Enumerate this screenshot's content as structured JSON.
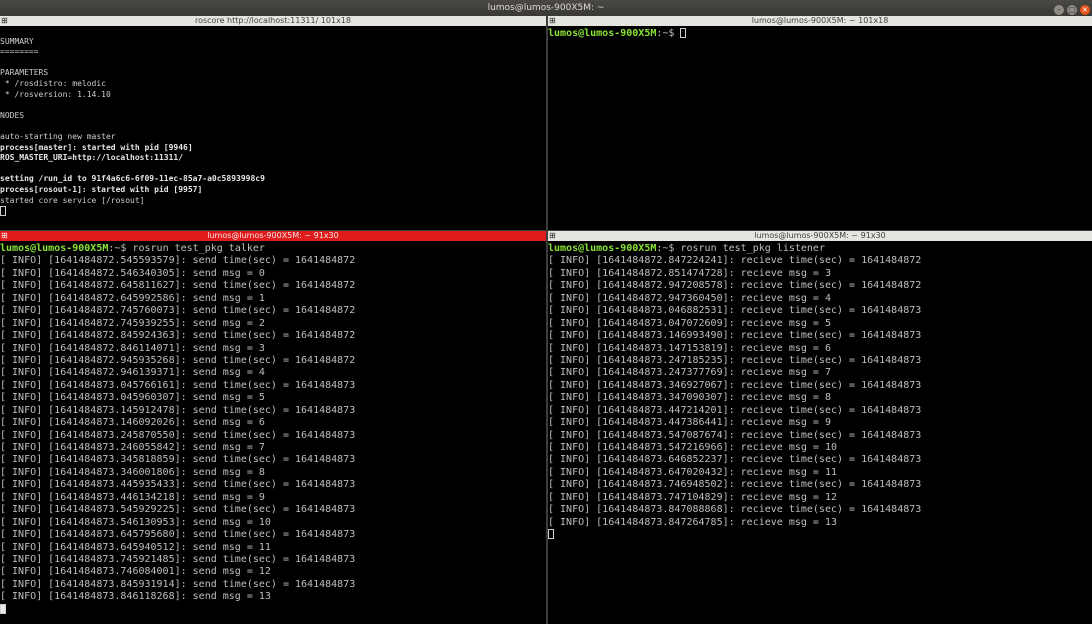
{
  "window": {
    "title": "lumos@lumos-900X5M: ~",
    "icons": [
      "minimize-icon",
      "maximize-icon",
      "close-icon"
    ]
  },
  "panes": {
    "roscore": {
      "title": "roscore http://localhost:11311/ 101x18",
      "lines": [
        {
          "text": "",
          "style": "small"
        },
        {
          "text": "SUMMARY",
          "style": "small"
        },
        {
          "text": "========",
          "style": "small"
        },
        {
          "text": "",
          "style": "small"
        },
        {
          "text": "PARAMETERS",
          "style": "small"
        },
        {
          "text": " * /rosdistro: melodic",
          "style": "small"
        },
        {
          "text": " * /rosversion: 1.14.10",
          "style": "small"
        },
        {
          "text": "",
          "style": "small"
        },
        {
          "text": "NODES",
          "style": "small"
        },
        {
          "text": "",
          "style": "small"
        },
        {
          "text": "auto-starting new master",
          "style": "small"
        },
        {
          "text": "process[master]: started with pid [9946]",
          "style": "small bold"
        },
        {
          "text": "ROS_MASTER_URI=http://localhost:11311/",
          "style": "small bold"
        },
        {
          "text": "",
          "style": "small"
        },
        {
          "text": "setting /run_id to 91f4a6c6-6f09-11ec-85a7-a0c5893998c9",
          "style": "small bold"
        },
        {
          "text": "process[rosout-1]: started with pid [9957]",
          "style": "small bold"
        },
        {
          "text": "started core service [/rosout]",
          "style": "small"
        }
      ]
    },
    "shell": {
      "title": "lumos@lumos-900X5M: ~ 101x18",
      "prompt_user": "lumos@lumos-900X5M",
      "prompt_rest": ":~$ "
    },
    "talker": {
      "title": "lumos@lumos-900X5M: ~ 91x30",
      "prompt_user": "lumos@lumos-900X5M",
      "prompt_rest": ":~$ ",
      "command": "rosrun test_pkg talker",
      "lines": [
        "[ INFO] [1641484872.545593579]: send time(sec) = 1641484872",
        "[ INFO] [1641484872.546340305]: send msg = 0",
        "[ INFO] [1641484872.645811627]: send time(sec) = 1641484872",
        "[ INFO] [1641484872.645992586]: send msg = 1",
        "[ INFO] [1641484872.745760073]: send time(sec) = 1641484872",
        "[ INFO] [1641484872.745939255]: send msg = 2",
        "[ INFO] [1641484872.845924363]: send time(sec) = 1641484872",
        "[ INFO] [1641484872.846114071]: send msg = 3",
        "[ INFO] [1641484872.945935268]: send time(sec) = 1641484872",
        "[ INFO] [1641484872.946139371]: send msg = 4",
        "[ INFO] [1641484873.045766161]: send time(sec) = 1641484873",
        "[ INFO] [1641484873.045960307]: send msg = 5",
        "[ INFO] [1641484873.145912478]: send time(sec) = 1641484873",
        "[ INFO] [1641484873.146092026]: send msg = 6",
        "[ INFO] [1641484873.245870550]: send time(sec) = 1641484873",
        "[ INFO] [1641484873.246055842]: send msg = 7",
        "[ INFO] [1641484873.345818859]: send time(sec) = 1641484873",
        "[ INFO] [1641484873.346001806]: send msg = 8",
        "[ INFO] [1641484873.445935433]: send time(sec) = 1641484873",
        "[ INFO] [1641484873.446134218]: send msg = 9",
        "[ INFO] [1641484873.545929225]: send time(sec) = 1641484873",
        "[ INFO] [1641484873.546130953]: send msg = 10",
        "[ INFO] [1641484873.645795680]: send time(sec) = 1641484873",
        "[ INFO] [1641484873.645940512]: send msg = 11",
        "[ INFO] [1641484873.745921485]: send time(sec) = 1641484873",
        "[ INFO] [1641484873.746084001]: send msg = 12",
        "[ INFO] [1641484873.845931914]: send time(sec) = 1641484873",
        "[ INFO] [1641484873.846118268]: send msg = 13"
      ]
    },
    "listener": {
      "title": "lumos@lumos-900X5M: ~ 91x30",
      "prompt_user": "lumos@lumos-900X5M",
      "prompt_rest": ":~$ ",
      "command": "rosrun test_pkg listener",
      "lines": [
        "[ INFO] [1641484872.847224241]: recieve time(sec) = 1641484872",
        "[ INFO] [1641484872.851474728]: recieve msg = 3",
        "[ INFO] [1641484872.947208578]: recieve time(sec) = 1641484872",
        "[ INFO] [1641484872.947360450]: recieve msg = 4",
        "[ INFO] [1641484873.046882531]: recieve time(sec) = 1641484873",
        "[ INFO] [1641484873.047072609]: recieve msg = 5",
        "[ INFO] [1641484873.146993490]: recieve time(sec) = 1641484873",
        "[ INFO] [1641484873.147153819]: recieve msg = 6",
        "[ INFO] [1641484873.247185235]: recieve time(sec) = 1641484873",
        "[ INFO] [1641484873.247377769]: recieve msg = 7",
        "[ INFO] [1641484873.346927067]: recieve time(sec) = 1641484873",
        "[ INFO] [1641484873.347090307]: recieve msg = 8",
        "[ INFO] [1641484873.447214201]: recieve time(sec) = 1641484873",
        "[ INFO] [1641484873.447386441]: recieve msg = 9",
        "[ INFO] [1641484873.547087674]: recieve time(sec) = 1641484873",
        "[ INFO] [1641484873.547216966]: recieve msg = 10",
        "[ INFO] [1641484873.646852237]: recieve time(sec) = 1641484873",
        "[ INFO] [1641484873.647020432]: recieve msg = 11",
        "[ INFO] [1641484873.746948502]: recieve time(sec) = 1641484873",
        "[ INFO] [1641484873.747104829]: recieve msg = 12",
        "[ INFO] [1641484873.847088868]: recieve time(sec) = 1641484873",
        "[ INFO] [1641484873.847264785]: recieve msg = 13"
      ]
    }
  },
  "colors": {
    "prompt": "#8ae234",
    "active_title": "#e01b1b",
    "scroll_mark": "#d56b36",
    "close_button": "#e9541d"
  }
}
